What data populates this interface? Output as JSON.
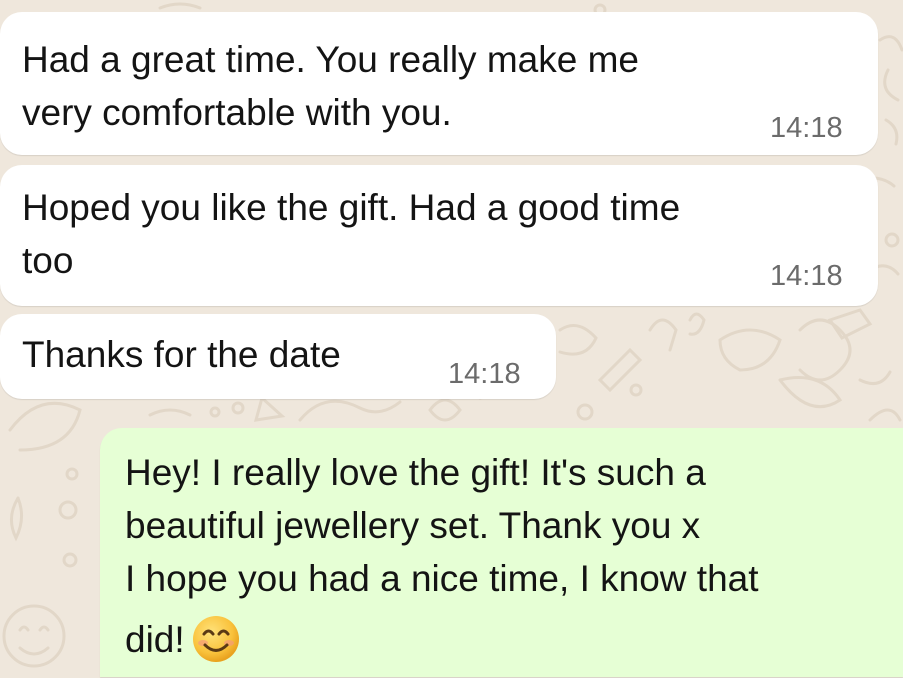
{
  "messages": [
    {
      "direction": "incoming",
      "lines": [
        "Had a great time. You really make me",
        "very comfortable with you."
      ],
      "time": "14:18"
    },
    {
      "direction": "incoming",
      "lines": [
        "Hoped you like the gift. Had a good time",
        "too"
      ],
      "time": "14:18"
    },
    {
      "direction": "incoming",
      "lines": [
        "Thanks for the date"
      ],
      "time": "14:18"
    },
    {
      "direction": "outgoing",
      "lines": [
        "Hey! I really love the gift! It's such a",
        "beautiful jewellery set. Thank you x",
        "I hope you had a nice time, I know that",
        "did!"
      ],
      "emoji": "smiling-face-icon"
    }
  ],
  "colors": {
    "wallpaper": "#efe7dc",
    "incoming_bubble": "#ffffff",
    "outgoing_bubble": "#e6ffd5",
    "text": "#141414",
    "timestamp": "#6b6b6b"
  }
}
